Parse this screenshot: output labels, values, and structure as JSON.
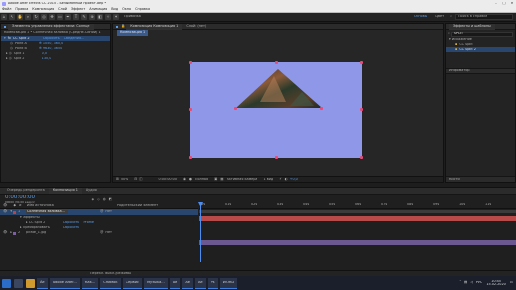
{
  "window": {
    "title": "Adobe After Effects CC 2015 - Безымянный проект.aep *"
  },
  "menu": [
    "Файл",
    "Правка",
    "Композиция",
    "Слой",
    "Эффект",
    "Анимация",
    "Вид",
    "Окно",
    "Справка"
  ],
  "toolbar": {
    "workspace_label": "Стандарт",
    "align_label": "Привязка",
    "ws_default": "Основы",
    "ws_current": "Цвет",
    "search_placeholder": "Поиск в справке"
  },
  "effects_panel": {
    "tab_project": "Проект",
    "tab_label": "Элементы управления эффектами: Солнце",
    "comp_line": "Композиция 1 • Солнечная заливка (Средне-Синий) 1",
    "fx_name": "CC Split 2",
    "reset": "Сбросить",
    "about": "Сведения...",
    "props": [
      {
        "name": "Point A",
        "value": "1050, 360,0"
      },
      {
        "name": "Point B",
        "value": "9630, 3650"
      },
      {
        "name": "Split 1",
        "value": "0,0"
      },
      {
        "name": "Split 2",
        "value": "130,0"
      }
    ],
    "small_label": "Этом"
  },
  "composition": {
    "tab_label": "Композиция Композиция 1",
    "breadcrumb": "Композиция 1",
    "layer_tab": "Слой: (нет)",
    "footer": {
      "zoom": "50%",
      "timecode": "0:00:00:00",
      "quality": "Полная",
      "camera": "Активная камера",
      "views": "1 вид",
      "offset": "+0,0"
    }
  },
  "right_panel": {
    "tab_label": "Эффекты и шаблоны",
    "search_value": "SPLIT",
    "category": "Искажение",
    "items": [
      "CC Split",
      "CC Split 2"
    ],
    "preview_tab": "Просмотр",
    "info_label": "Инфоматор",
    "bottom_label": "Кисти"
  },
  "timeline": {
    "tab_render": "Очередь рендеринга",
    "tab_comp": "Композиция 1",
    "tab_extra": "Аудио",
    "timecode": "0:00:00:00",
    "frame_sub": "00000 (30.00 кадр/с)",
    "header": {
      "num": "#",
      "name": "Имя источника",
      "parent": "Родительский элемент"
    },
    "layers": [
      {
        "num": "1",
        "name": "Солнечная заливка...",
        "parent": "Нет",
        "color": "#c14242"
      },
      {
        "num": "2",
        "name": "pirate_1.jpg",
        "parent": "Нет",
        "color": "#7c5fa0"
      }
    ],
    "sub_effects": "Эффекты",
    "sub_fx": "CC Split 2",
    "sub_reset": "Сбросить",
    "sub_fx_extra": "Profile",
    "sub_transform": "Преобразовать",
    "sub_reset2": "Сбросить",
    "ruler": [
      "00s",
      "01s",
      "02s",
      "03s",
      "04s",
      "05s",
      "06s",
      "07s",
      "08s",
      "09s",
      "10s",
      "11s",
      "12s"
    ],
    "status": "Перекл. выкл./режимы"
  },
  "taskbar": {
    "apps": [
      "Ae",
      "Adobe After...",
      "Как...",
      "Снимок",
      "Сервис",
      "Музыка...",
      "Ae",
      "Ae",
      "Ae",
      "Ps",
      "WORD"
    ],
    "lang": "РУС",
    "time": "10:45",
    "date": "15.02.2020"
  }
}
